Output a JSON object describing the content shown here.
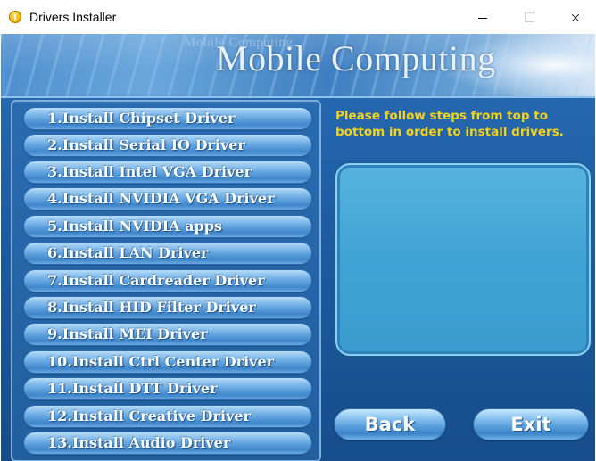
{
  "window": {
    "title": "Drivers Installer",
    "close_glyph": "×"
  },
  "banner": {
    "title": "Mobile Computing",
    "watermark": "Mobile Computing"
  },
  "install_list": [
    {
      "label": "1.Install Chipset Driver"
    },
    {
      "label": "2.Install Serial IO Driver"
    },
    {
      "label": "3.Install Intel VGA Driver"
    },
    {
      "label": "4.Install NVIDIA VGA Driver"
    },
    {
      "label": "5.Install NVIDIA apps"
    },
    {
      "label": "6.Install LAN Driver"
    },
    {
      "label": "7.Install Cardreader Driver"
    },
    {
      "label": "8.Install HID Filter Driver"
    },
    {
      "label": "9.Install MEI Driver"
    },
    {
      "label": "10.Install Ctrl Center Driver"
    },
    {
      "label": "11.Install DTT Driver"
    },
    {
      "label": "12.Install Creative Driver"
    },
    {
      "label": "13.Install Audio Driver"
    }
  ],
  "instructions": "Please follow steps from top to bottom in order to install drivers.",
  "buttons": {
    "back_label": "Back",
    "exit_label": "Exit"
  },
  "colors": {
    "instruction_text": "#f3d21b",
    "panel_blue": "#1f5fa6",
    "button_blue": "#5c9fdb"
  },
  "icons": {
    "app": "app-icon",
    "minimize": "minimize-icon",
    "maximize": "maximize-icon",
    "close": "close-icon"
  }
}
